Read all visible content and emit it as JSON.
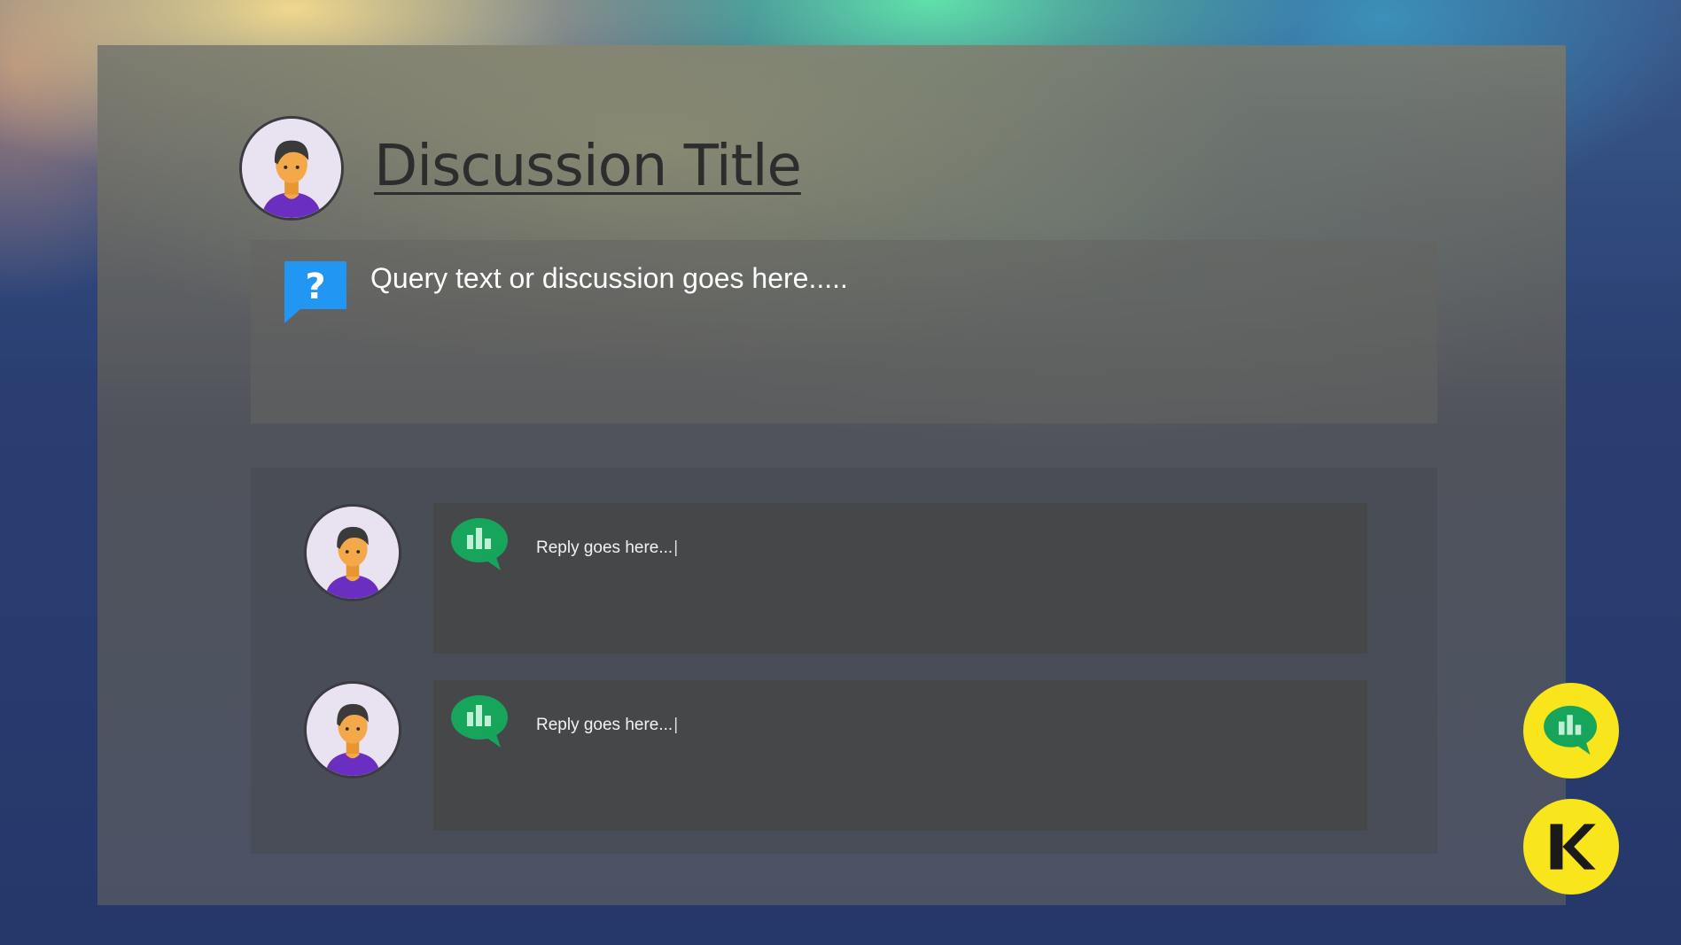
{
  "discussion": {
    "title": "Discussion Title",
    "query_text": "Query text or discussion goes here.....",
    "question_icon": "question-speech-bubble-icon"
  },
  "replies": [
    {
      "text": "Reply goes here...",
      "icon": "chart-speech-bubble-icon"
    },
    {
      "text": "Reply goes here...",
      "icon": "chart-speech-bubble-icon"
    }
  ],
  "floating_buttons": [
    {
      "icon": "chart-speech-bubble-icon"
    },
    {
      "icon": "k-logo-icon"
    }
  ],
  "colors": {
    "accent_yellow": "#f9e51b",
    "reply_icon_green": "#17a45b",
    "question_icon_blue": "#2196f3",
    "avatar_shirt": "#6a2fc0",
    "avatar_skin": "#f3a94a"
  }
}
